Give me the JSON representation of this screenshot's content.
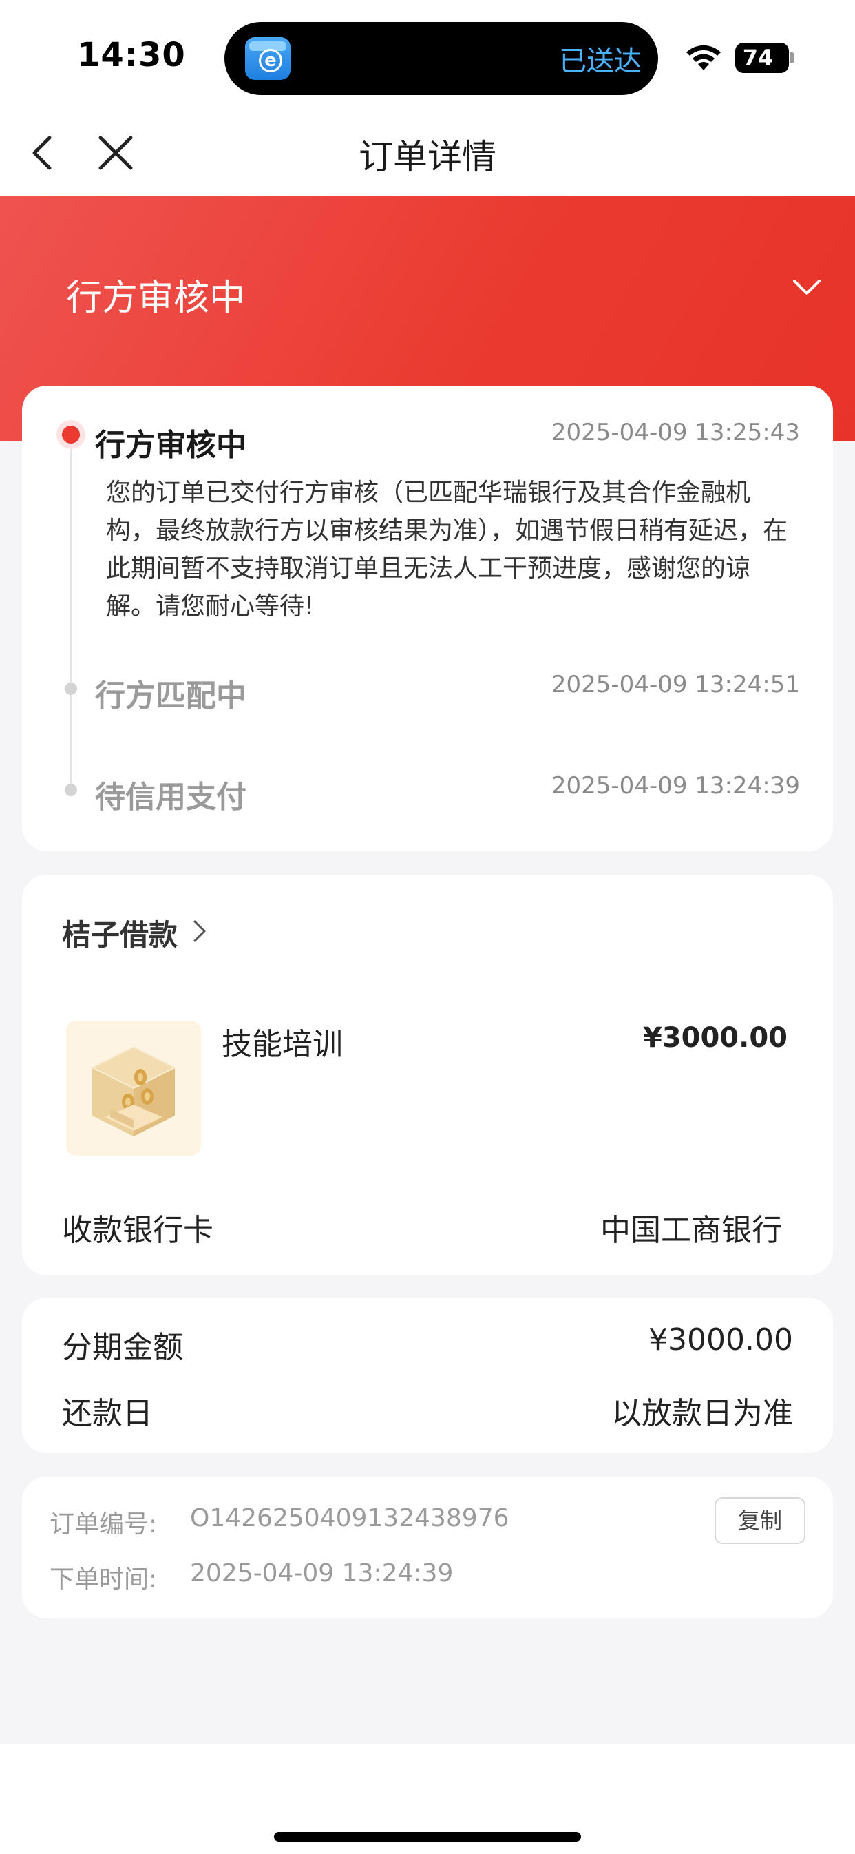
{
  "status_bar": {
    "time": "14:30",
    "island_text": "已送达",
    "battery": "74"
  },
  "nav": {
    "title": "订单详情"
  },
  "header": {
    "status": "行方审核中"
  },
  "timeline": {
    "steps": [
      {
        "title": "行方审核中",
        "time": "2025-04-09 13:25:43",
        "description": "您的订单已交付行方审核（已匹配华瑞银行及其合作金融机构，最终放款行方以审核结果为准），如遇节假日稍有延迟，在此期间暂不支持取消订单且无法人工干预进度，感谢您的谅解。请您耐心等待!"
      },
      {
        "title": "行方匹配中",
        "time": "2025-04-09 13:24:51"
      },
      {
        "title": "待信用支付",
        "time": "2025-04-09 13:24:39"
      }
    ]
  },
  "product": {
    "merchant": "桔子借款",
    "name": "技能培训",
    "price": "¥3000.00",
    "bank_card_label": "收款银行卡",
    "bank_card_value": "中国工商银行"
  },
  "amount": {
    "installment_label": "分期金额",
    "installment_value": "¥3000.00",
    "repay_label": "还款日",
    "repay_value": "以放款日为准"
  },
  "order": {
    "number_label": "订单编号:",
    "number_value": "O1426250409132438976",
    "time_label": "下单时间:",
    "time_value": "2025-04-09 13:24:39",
    "copy_label": "复制"
  },
  "colors": {
    "accent": "#ea3b30",
    "island_text": "#4ab3ff"
  }
}
